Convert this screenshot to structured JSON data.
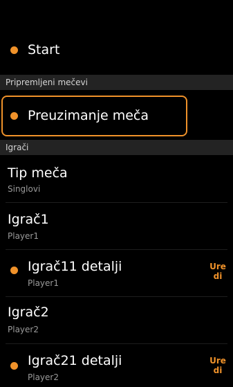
{
  "start": {
    "label": "Start"
  },
  "sections": {
    "prepared": "Pripremljeni mečevi",
    "players": "Igrači"
  },
  "download_match": {
    "label": "Preuzimanje meča"
  },
  "match_type": {
    "title": "Tip meča",
    "value": "Singlovi"
  },
  "player1": {
    "title": "Igrač1",
    "value": "Player1"
  },
  "player11_details": {
    "title": "Igrač11 detalji",
    "value": "Player1",
    "edit_label": "Uredi"
  },
  "player2": {
    "title": "Igrač2",
    "value": "Player2"
  },
  "player21_details": {
    "title": "Igrač21 detalji",
    "value": "Player2",
    "edit_label": "Uredi"
  },
  "colors": {
    "accent": "#f0922a",
    "background": "#000000",
    "section_header": "#232323",
    "secondary_text": "#9a9a9a"
  }
}
